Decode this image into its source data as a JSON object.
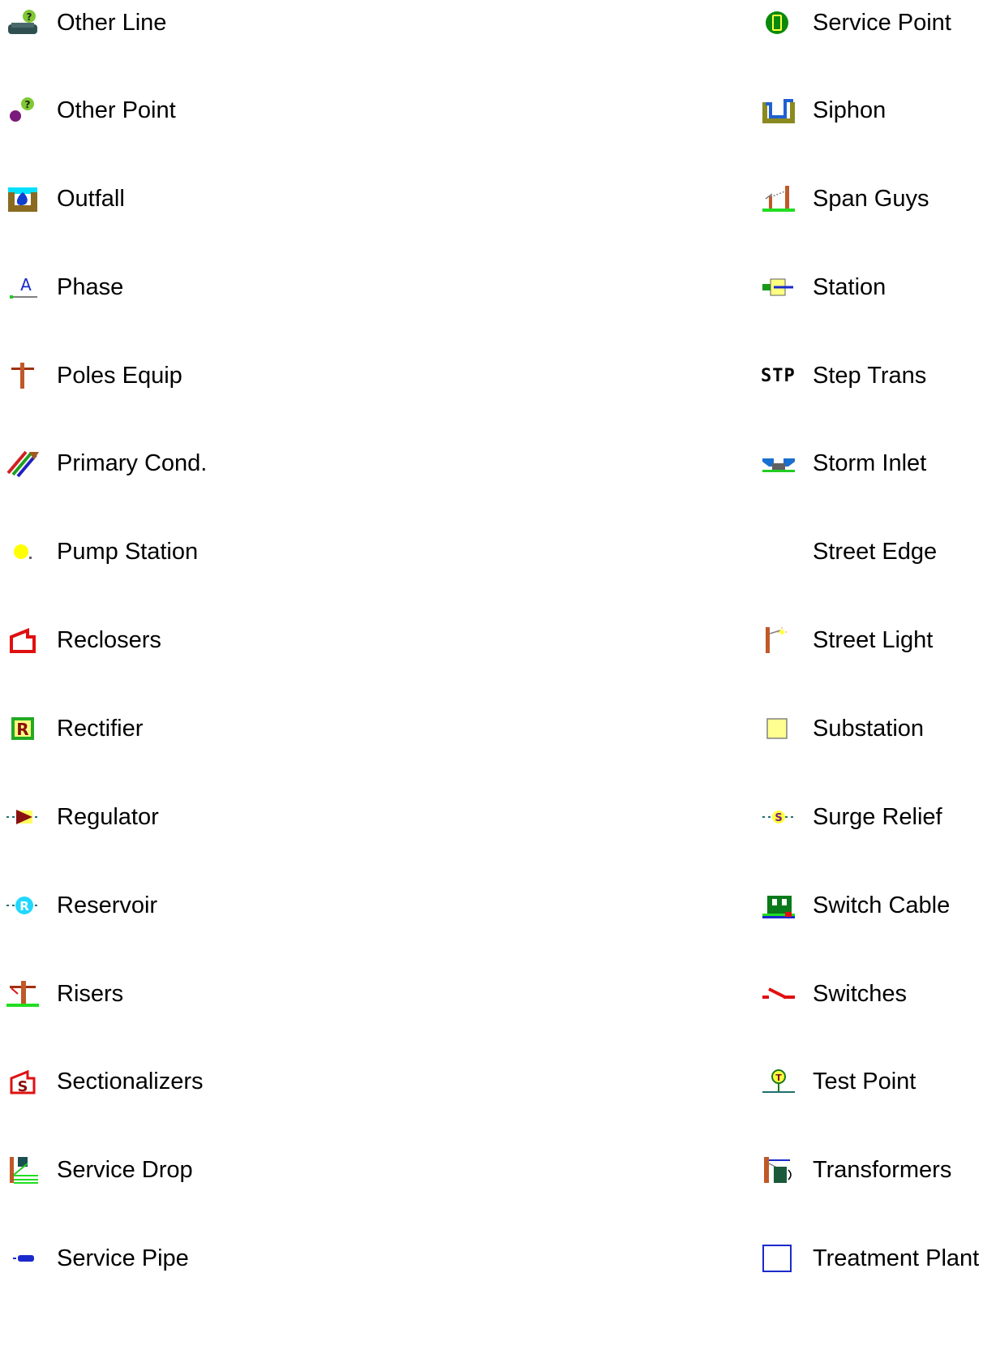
{
  "legend": {
    "left": [
      {
        "label": "Other Line",
        "icon": "other-line-icon"
      },
      {
        "label": "Other Point",
        "icon": "other-point-icon"
      },
      {
        "label": "Outfall",
        "icon": "outfall-icon"
      },
      {
        "label": "Phase",
        "icon": "phase-icon"
      },
      {
        "label": "Poles Equip",
        "icon": "poles-equip-icon"
      },
      {
        "label": "Primary Cond.",
        "icon": "primary-cond-icon"
      },
      {
        "label": "Pump Station",
        "icon": "pump-station-icon"
      },
      {
        "label": "Reclosers",
        "icon": "reclosers-icon"
      },
      {
        "label": "Rectifier",
        "icon": "rectifier-icon"
      },
      {
        "label": "Regulator",
        "icon": "regulator-icon"
      },
      {
        "label": "Reservoir",
        "icon": "reservoir-icon"
      },
      {
        "label": "Risers",
        "icon": "risers-icon"
      },
      {
        "label": "Sectionalizers",
        "icon": "sectionalizers-icon"
      },
      {
        "label": "Service Drop",
        "icon": "service-drop-icon"
      },
      {
        "label": "Service Pipe",
        "icon": "service-pipe-icon"
      }
    ],
    "right": [
      {
        "label": "Service Point",
        "icon": "service-point-icon"
      },
      {
        "label": "Siphon",
        "icon": "siphon-icon"
      },
      {
        "label": "Span Guys",
        "icon": "span-guys-icon"
      },
      {
        "label": "Station",
        "icon": "station-icon"
      },
      {
        "label": "Step Trans",
        "icon": "step-trans-icon",
        "icon_text": "STP"
      },
      {
        "label": "Storm Inlet",
        "icon": "storm-inlet-icon"
      },
      {
        "label": "Street Edge",
        "icon": "street-edge-icon"
      },
      {
        "label": "Street Light",
        "icon": "street-light-icon"
      },
      {
        "label": "Substation",
        "icon": "substation-icon"
      },
      {
        "label": "Surge Relief",
        "icon": "surge-relief-icon"
      },
      {
        "label": "Switch Cable",
        "icon": "switch-cable-icon"
      },
      {
        "label": "Switches",
        "icon": "switches-icon"
      },
      {
        "label": "Test Point",
        "icon": "test-point-icon"
      },
      {
        "label": "Transformers",
        "icon": "transformers-icon"
      },
      {
        "label": "Treatment Plant",
        "icon": "treatment-plant-icon"
      }
    ]
  }
}
